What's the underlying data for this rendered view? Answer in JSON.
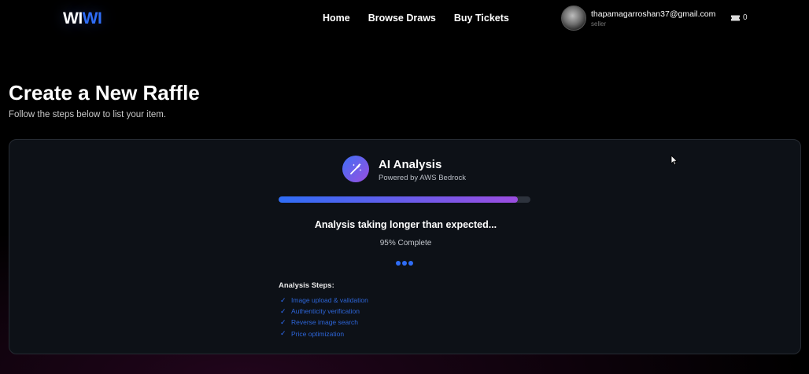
{
  "header": {
    "logo_part1": "WI",
    "logo_part2": "WI",
    "nav": [
      "Home",
      "Browse Draws",
      "Buy Tickets"
    ],
    "user_email": "thapamagarroshan37@gmail.com",
    "user_role": "seller",
    "cart_icon": "ticket-icon",
    "cart_count": "0"
  },
  "page": {
    "title": "Create a New Raffle",
    "subtitle": "Follow the steps below to list your item."
  },
  "analysis": {
    "icon": "magic-wand-icon",
    "title": "AI Analysis",
    "subtitle": "Powered by AWS Bedrock",
    "progress_percent": 95,
    "status": "Analysis taking longer than expected...",
    "percent_label": "95% Complete",
    "steps_heading": "Analysis Steps:",
    "steps": [
      "Image upload & validation",
      "Authenticity verification",
      "Reverse image search",
      "Price optimization"
    ]
  },
  "colors": {
    "accent_blue": "#2f6df6",
    "accent_purple": "#9b4de0",
    "card_bg": "#0d1117"
  }
}
